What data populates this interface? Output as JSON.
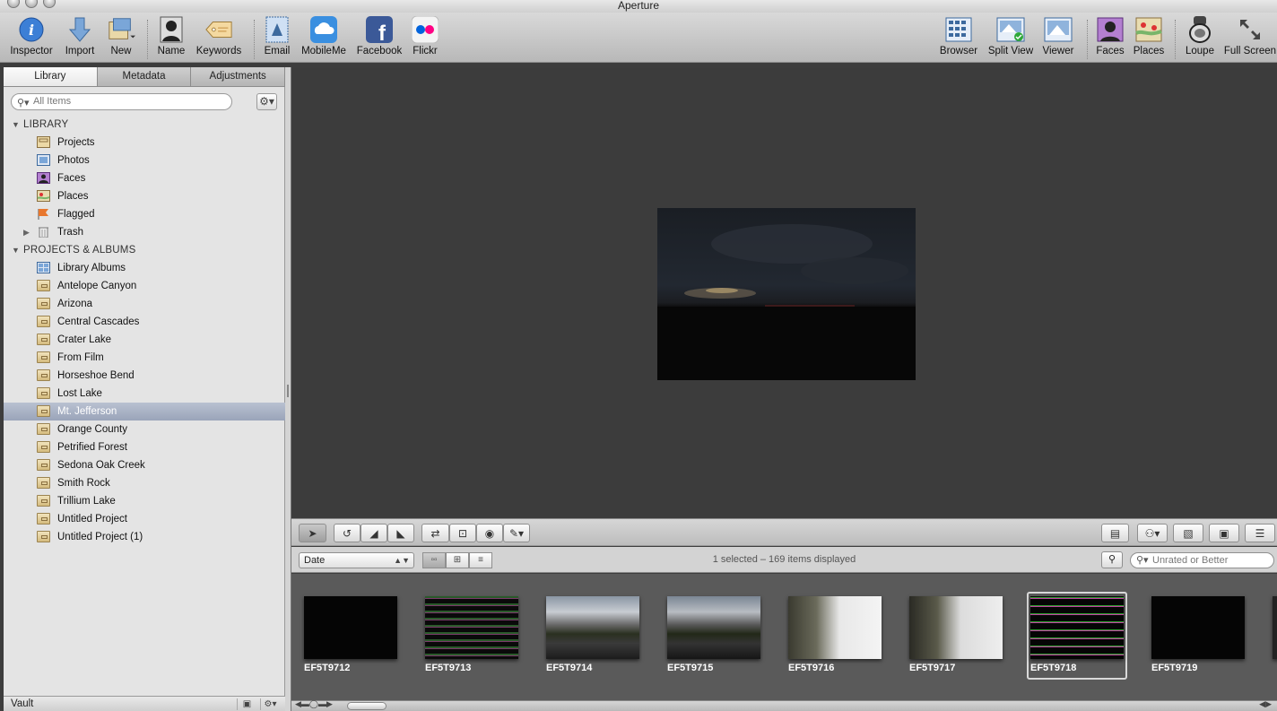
{
  "window": {
    "title": "Aperture"
  },
  "toolbar": {
    "left": [
      {
        "label": "Inspector",
        "icon": "info-icon"
      },
      {
        "label": "Import",
        "icon": "import-arrow-icon"
      },
      {
        "label": "New",
        "icon": "new-project-icon"
      },
      {
        "label": "Name",
        "icon": "name-silhouette-icon"
      },
      {
        "label": "Keywords",
        "icon": "keyword-tag-icon"
      },
      {
        "label": "Email",
        "icon": "email-stamp-icon"
      },
      {
        "label": "MobileMe",
        "icon": "mobileme-cloud-icon"
      },
      {
        "label": "Facebook",
        "icon": "facebook-icon"
      },
      {
        "label": "Flickr",
        "icon": "flickr-icon"
      }
    ],
    "right": [
      {
        "label": "Browser",
        "icon": "browser-grid-icon"
      },
      {
        "label": "Split View",
        "icon": "split-view-icon"
      },
      {
        "label": "Viewer",
        "icon": "viewer-icon"
      },
      {
        "label": "Faces",
        "icon": "faces-icon"
      },
      {
        "label": "Places",
        "icon": "places-map-icon"
      },
      {
        "label": "Loupe",
        "icon": "loupe-icon"
      },
      {
        "label": "Full Screen",
        "icon": "full-screen-icon"
      }
    ]
  },
  "sidebar": {
    "tabs": [
      "Library",
      "Metadata",
      "Adjustments"
    ],
    "active_tab": "Library",
    "search_placeholder": "All Items",
    "library_header": "LIBRARY",
    "library_items": [
      "Projects",
      "Photos",
      "Faces",
      "Places",
      "Flagged",
      "Trash"
    ],
    "projects_header": "PROJECTS & ALBUMS",
    "project_items": [
      "Library Albums",
      "Antelope Canyon",
      "Arizona",
      "Central Cascades",
      "Crater Lake",
      "From Film",
      "Horseshoe Bend",
      "Lost Lake",
      "Mt. Jefferson",
      "Orange County",
      "Petrified Forest",
      "Sedona Oak Creek",
      "Smith Rock",
      "Trillium Lake",
      "Untitled Project",
      "Untitled Project (1)"
    ],
    "selected_project": "Mt. Jefferson",
    "vault_label": "Vault"
  },
  "browser": {
    "sort_label": "Date",
    "status": "1 selected – 169 items displayed",
    "rating_filter": "Unrated or Better",
    "thumbnails": [
      "EF5T9712",
      "EF5T9713",
      "EF5T9714",
      "EF5T9715",
      "EF5T9716",
      "EF5T9717",
      "EF5T9718",
      "EF5T9719"
    ],
    "selected_thumbnail": "EF5T9718"
  },
  "colors": {
    "selection": "#a3acc0",
    "viewer_bg": "#3c3c3c",
    "filmstrip_bg": "#5a5a5a"
  }
}
